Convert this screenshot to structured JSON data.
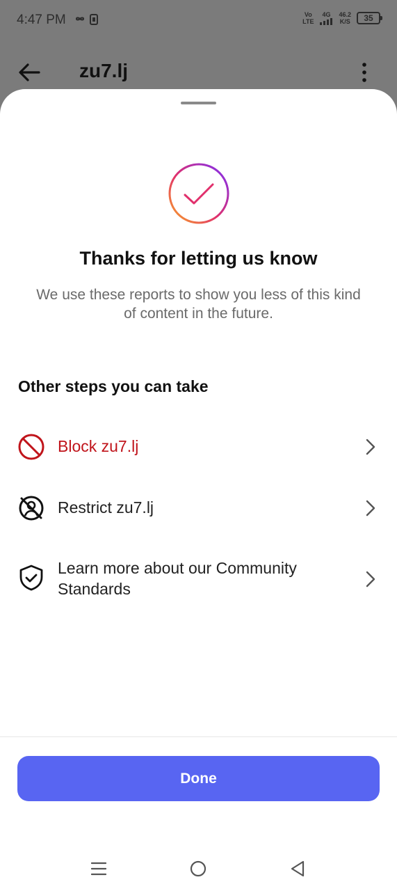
{
  "status_bar": {
    "time": "4:47 PM",
    "network_top": "Vo",
    "network_bottom": "LTE",
    "net_type": "4G",
    "speed_value": "46.2",
    "speed_unit": "K/S",
    "battery": "35"
  },
  "header": {
    "title": "zu7.lj",
    "back_icon": "arrow-left-icon",
    "more_icon": "more-vertical-icon"
  },
  "sheet": {
    "title": "Thanks for letting us know",
    "subtitle": "We use these reports to show you less of this kind of content in the future.",
    "steps_heading": "Other steps you can take",
    "options": [
      {
        "label": "Block zu7.lj",
        "icon": "block-icon",
        "style": "danger"
      },
      {
        "label": "Restrict zu7.lj",
        "icon": "restrict-icon",
        "style": "normal"
      },
      {
        "label": "Learn more about our Community Standards",
        "icon": "shield-check-icon",
        "style": "normal"
      }
    ],
    "done_label": "Done"
  },
  "colors": {
    "accent": "#5865f2",
    "danger": "#c0141b",
    "dim_background": "#7b7b7b"
  }
}
